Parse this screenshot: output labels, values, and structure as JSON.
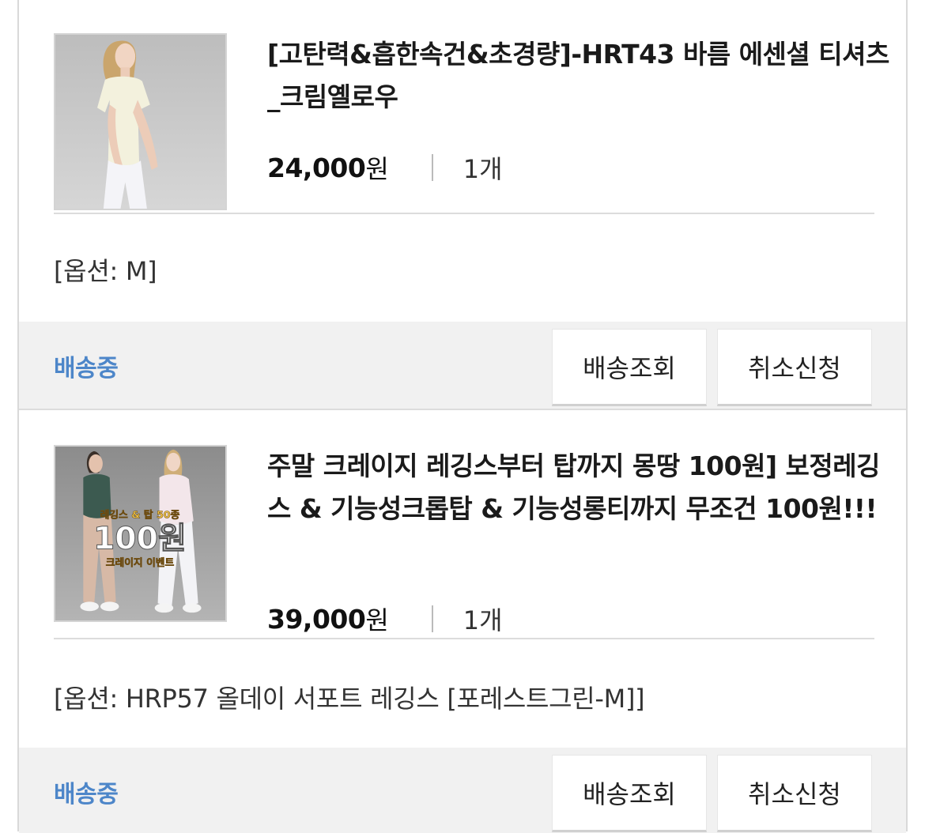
{
  "orders": [
    {
      "title": "[고탄력&흡한속건&초경량]-HRT43 바름 에센셜 티셔츠_크림옐로우",
      "price": "24,000",
      "currency": "원",
      "quantity": "1개",
      "option": "[옵션: M]",
      "status": "배송중",
      "track_label": "배송조회",
      "cancel_label": "취소신청"
    },
    {
      "title": "주말 크레이지 레깅스부터 탑까지 몽땅 100원] 보정레깅스 & 기능성크롭탑 & 기능성롱티까지 무조건 100원!!!",
      "price": "39,000",
      "currency": "원",
      "quantity": "1개",
      "option": "[옵션: HRP57 올데이 서포트 레깅스 [포레스트그린-M]]",
      "status": "배송중",
      "track_label": "배송조회",
      "cancel_label": "취소신청",
      "image_text": {
        "line1": "레깅스 & 탑 50종",
        "line2": "100원",
        "line3": "크레이지 이벤트"
      }
    }
  ],
  "colors": {
    "status": "#4d86c9",
    "footer_bg": "#f1f1f1"
  }
}
